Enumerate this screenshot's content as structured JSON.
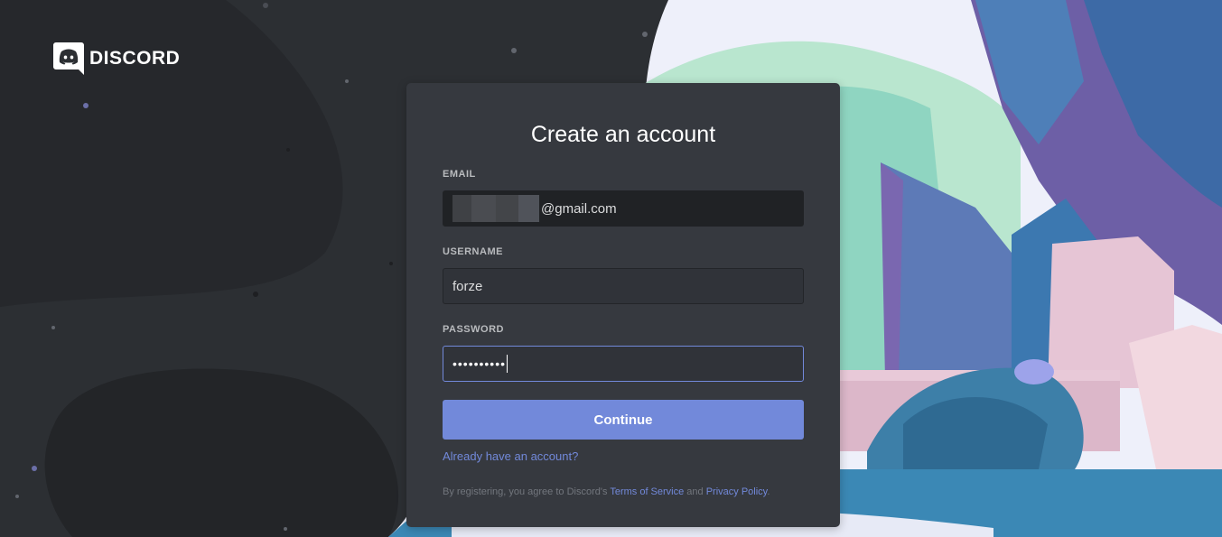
{
  "brand": {
    "name": "DISCORD",
    "icon": "discord-logo-icon"
  },
  "colors": {
    "accent": "#7289da",
    "card": "#36393f",
    "background": "#2c2f33"
  },
  "form": {
    "title": "Create an account",
    "email": {
      "label": "EMAIL",
      "value": "@gmail.com"
    },
    "username": {
      "label": "USERNAME",
      "value": "forze"
    },
    "password": {
      "label": "PASSWORD",
      "value": "••••••••••"
    },
    "continue_label": "Continue",
    "login_link": "Already have an account?",
    "legal": {
      "prefix": "By registering, you agree to Discord's ",
      "terms": "Terms of Service",
      "middle": " and ",
      "privacy": "Privacy Policy",
      "suffix": "."
    }
  }
}
